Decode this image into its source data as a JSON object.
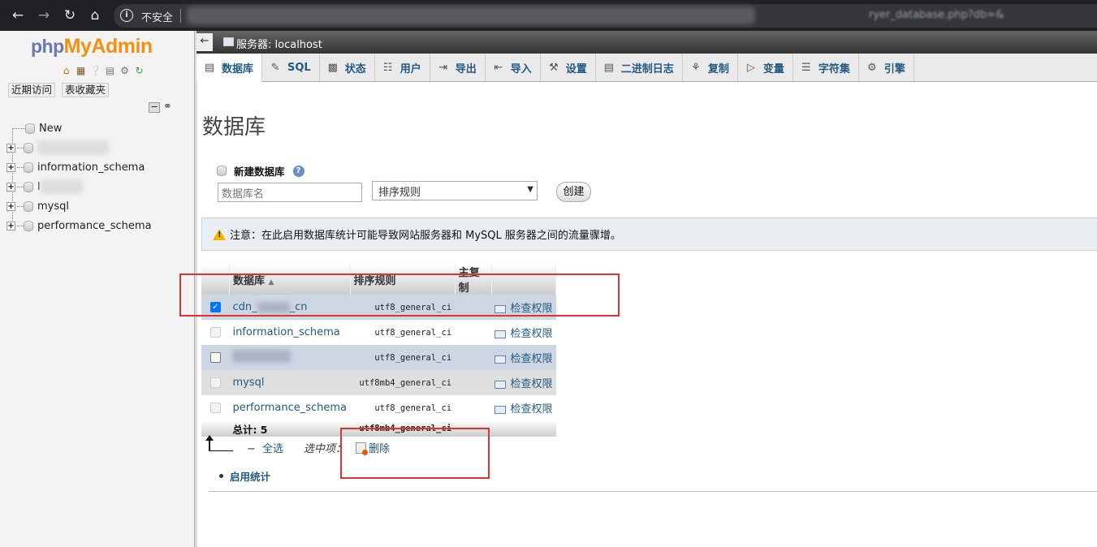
{
  "browser": {
    "security_text": "不安全",
    "url_tail": "ryer_database.php?db=&"
  },
  "sidebar": {
    "logo": {
      "php": "php",
      "my": "My",
      "admin": "Admin"
    },
    "quick_links": [
      "近期访问",
      "表收藏夹"
    ],
    "tree": [
      {
        "label": "New",
        "blurred": false
      },
      {
        "label": "",
        "blurred": true
      },
      {
        "label": "information_schema",
        "blurred": false
      },
      {
        "label": "l",
        "blurred": true
      },
      {
        "label": "mysql",
        "blurred": false
      },
      {
        "label": "performance_schema",
        "blurred": false
      }
    ]
  },
  "server_bar": {
    "label": "服务器: localhost"
  },
  "tabs": [
    {
      "label": "数据库",
      "icon": "database-icon",
      "active": true
    },
    {
      "label": "SQL",
      "icon": "sql-icon"
    },
    {
      "label": "状态",
      "icon": "status-icon"
    },
    {
      "label": "用户",
      "icon": "users-icon"
    },
    {
      "label": "导出",
      "icon": "export-icon"
    },
    {
      "label": "导入",
      "icon": "import-icon"
    },
    {
      "label": "设置",
      "icon": "settings-icon"
    },
    {
      "label": "二进制日志",
      "icon": "binlog-icon"
    },
    {
      "label": "复制",
      "icon": "replication-icon"
    },
    {
      "label": "变量",
      "icon": "variables-icon"
    },
    {
      "label": "字符集",
      "icon": "charset-icon"
    },
    {
      "label": "引擎",
      "icon": "engine-icon"
    }
  ],
  "main": {
    "title": "数据库",
    "new_db": {
      "label": "新建数据库",
      "name_placeholder": "数据库名",
      "collation_selected": "排序规则",
      "create_button": "创建"
    },
    "notice": "注意：在此启用数据库统计可能导致网站服务器和 MySQL 服务器之间的流量骤增。",
    "table": {
      "headers": {
        "database": "数据库",
        "collation": "排序规则",
        "master_replication": "主复制"
      },
      "rows": [
        {
          "name_start": "cdn_",
          "name_end": "_cn",
          "collation": "utf8_general_ci",
          "privileges": "检查权限",
          "checked": true,
          "disabled": false
        },
        {
          "name": "information_schema",
          "collation": "utf8_general_ci",
          "privileges": "检查权限",
          "checked": false,
          "disabled": true
        },
        {
          "name": "",
          "collation": "utf8_general_ci",
          "privileges": "检查权限",
          "checked": false,
          "disabled": false
        },
        {
          "name": "mysql",
          "collation": "utf8mb4_general_ci",
          "privileges": "检查权限",
          "checked": false,
          "disabled": true
        },
        {
          "name": "performance_schema",
          "collation": "utf8_general_ci",
          "privileges": "检查权限",
          "checked": false,
          "disabled": true
        }
      ],
      "footer": {
        "total": "总计: 5",
        "collation": "utf8mb4_general_ci"
      }
    },
    "bottom": {
      "select_all": "全选",
      "with_selected": "选中项：",
      "delete": "删除",
      "enable_stats": "启用统计"
    }
  },
  "colors": {
    "accent": "#235a81",
    "highlight": "#e0332f",
    "selected_row": "#ced6e3"
  }
}
